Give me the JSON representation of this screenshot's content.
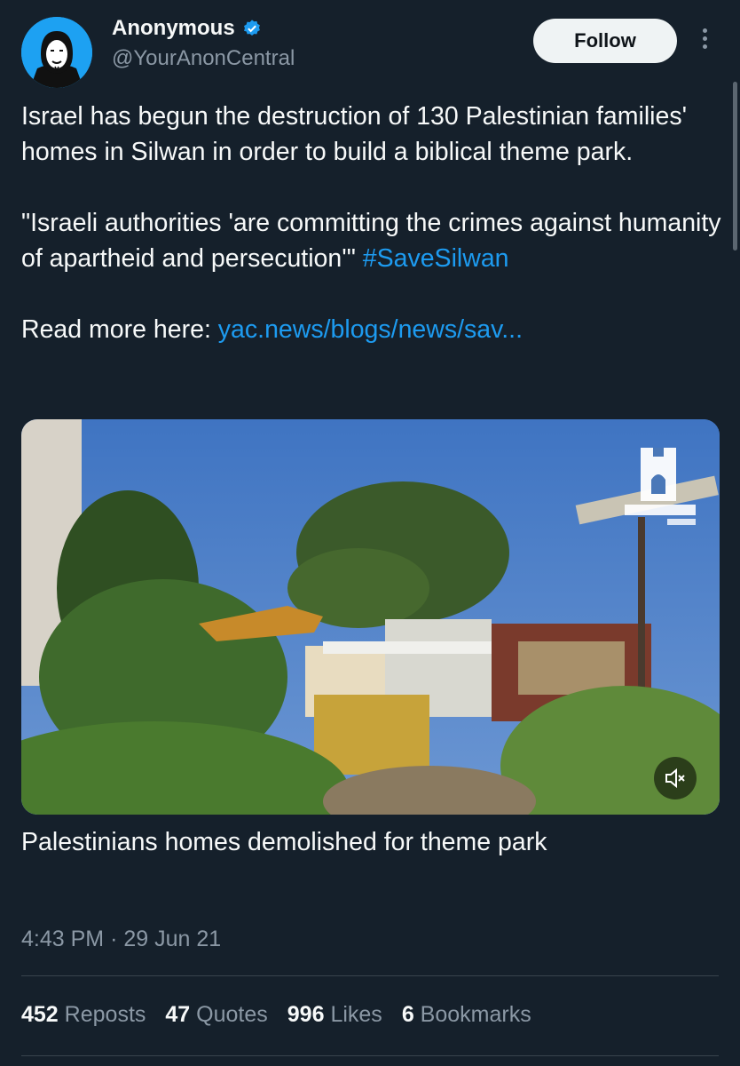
{
  "author": {
    "display_name": "Anonymous",
    "handle": "@YourAnonCentral",
    "verified": true,
    "avatar_icon": "anonymous-mask-avatar"
  },
  "actions": {
    "follow_label": "Follow",
    "more_icon": "more-vertical-icon"
  },
  "tweet": {
    "paragraph1": "Israel has begun the destruction of 130 Palestinian families' homes in Silwan in order to build a biblical theme park.",
    "quote": "\"Israeli authorities 'are committing the crimes against humanity of apartheid and persecution'\"",
    "hashtag": "#SaveSilwan",
    "read_more": "Read more here:",
    "link": "yac.news/blogs/news/sav..."
  },
  "media": {
    "type": "video",
    "muted": true,
    "mute_icon": "speaker-muted-icon",
    "watermark_icon": "al-quds-watermark-icon",
    "caption": "Palestinians homes demolished for theme park"
  },
  "meta": {
    "time": "4:43 PM",
    "separator": "·",
    "date": "29 Jun 21"
  },
  "stats": {
    "reposts_count": "452",
    "reposts_label": "Reposts",
    "quotes_count": "47",
    "quotes_label": "Quotes",
    "likes_count": "996",
    "likes_label": "Likes",
    "bookmarks_count": "6",
    "bookmarks_label": "Bookmarks"
  },
  "colors": {
    "background": "#15202b",
    "link": "#1d9bf0",
    "muted_text": "#8b98a5"
  }
}
